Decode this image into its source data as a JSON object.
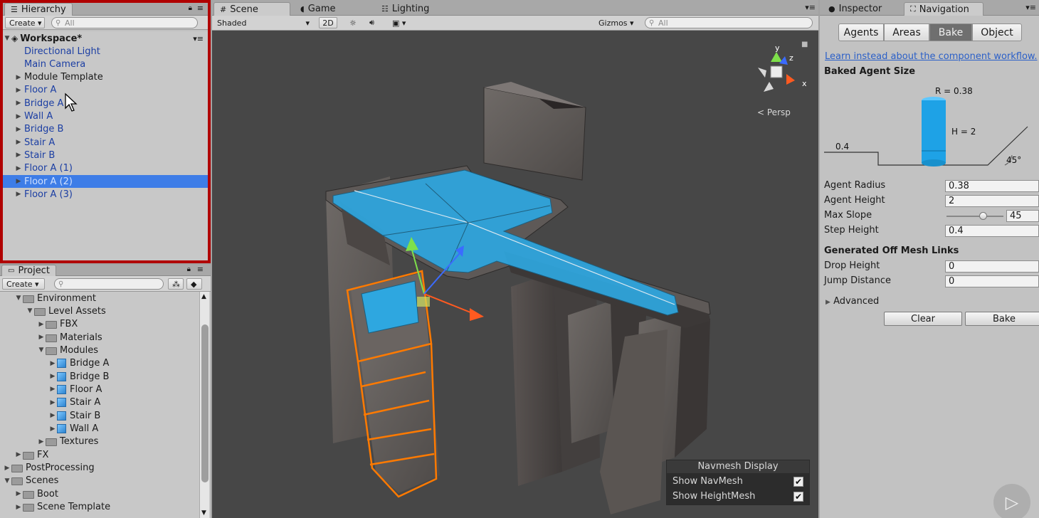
{
  "hierarchy": {
    "tab_label": "Hierarchy",
    "create_label": "Create",
    "search_placeholder": "All",
    "root": "Workspace*",
    "items": [
      {
        "label": "Directional Light",
        "expand": false
      },
      {
        "label": "Main Camera",
        "expand": false
      },
      {
        "label": "Module Template",
        "expand": true
      },
      {
        "label": "Floor A",
        "expand": true
      },
      {
        "label": "Bridge A",
        "expand": true
      },
      {
        "label": "Wall A",
        "expand": true
      },
      {
        "label": "Bridge B",
        "expand": true
      },
      {
        "label": "Stair A",
        "expand": true
      },
      {
        "label": "Stair B",
        "expand": true
      },
      {
        "label": "Floor A (1)",
        "expand": true
      },
      {
        "label": "Floor A (2)",
        "expand": true,
        "selected": true
      },
      {
        "label": "Floor A (3)",
        "expand": true
      }
    ]
  },
  "project": {
    "tab_label": "Project",
    "create_label": "Create",
    "items": [
      {
        "label": "Environment",
        "depth": 1,
        "state": "open",
        "icon": "folder-icon"
      },
      {
        "label": "Level Assets",
        "depth": 2,
        "state": "open",
        "icon": "folder-icon"
      },
      {
        "label": "FBX",
        "depth": 3,
        "state": "closed",
        "icon": "folder-icon"
      },
      {
        "label": "Materials",
        "depth": 3,
        "state": "closed",
        "icon": "folder-icon"
      },
      {
        "label": "Modules",
        "depth": 3,
        "state": "open",
        "icon": "folder-icon"
      },
      {
        "label": "Bridge A",
        "depth": 4,
        "state": "closed",
        "icon": "prefab-icon"
      },
      {
        "label": "Bridge B",
        "depth": 4,
        "state": "closed",
        "icon": "prefab-icon"
      },
      {
        "label": "Floor A",
        "depth": 4,
        "state": "closed",
        "icon": "prefab-icon"
      },
      {
        "label": "Stair A",
        "depth": 4,
        "state": "closed",
        "icon": "prefab-icon"
      },
      {
        "label": "Stair B",
        "depth": 4,
        "state": "closed",
        "icon": "prefab-icon"
      },
      {
        "label": "Wall A",
        "depth": 4,
        "state": "closed",
        "icon": "prefab-icon"
      },
      {
        "label": "Textures",
        "depth": 3,
        "state": "closed",
        "icon": "folder-icon"
      },
      {
        "label": "FX",
        "depth": 1,
        "state": "closed",
        "icon": "folder-icon"
      },
      {
        "label": "PostProcessing",
        "depth": 0,
        "state": "closed",
        "icon": "folder-icon"
      },
      {
        "label": "Scenes",
        "depth": 0,
        "state": "open",
        "icon": "folder-icon"
      },
      {
        "label": "Boot",
        "depth": 1,
        "state": "closed",
        "icon": "folder-icon"
      },
      {
        "label": "Scene Template",
        "depth": 1,
        "state": "closed",
        "icon": "folder-icon"
      }
    ]
  },
  "scene": {
    "tabs": [
      "Scene",
      "Game",
      "Lighting"
    ],
    "shading": "Shaded",
    "mode_2d": "2D",
    "gizmos": "Gizmos",
    "search_placeholder": "All",
    "persp": "Persp",
    "axis_y": "y",
    "axis_z": "z",
    "axis_x": "x",
    "navmesh_display": {
      "title": "Navmesh Display",
      "show_navmesh": "Show NavMesh",
      "show_heightmesh": "Show HeightMesh",
      "show_navmesh_checked": true,
      "show_heightmesh_checked": true
    }
  },
  "inspector": {
    "tabs": [
      "Inspector",
      "Navigation"
    ],
    "nav_tabs": [
      "Agents",
      "Areas",
      "Bake",
      "Object"
    ],
    "active_nav_tab": "Bake",
    "link": "Learn instead about the component workflow.",
    "baked_title": "Baked Agent Size",
    "diagram": {
      "r": "R = 0.38",
      "h": "H = 2",
      "step": "0.4",
      "slope": "45°"
    },
    "fields": [
      {
        "label": "Agent Radius",
        "value": "0.38"
      },
      {
        "label": "Agent Height",
        "value": "2"
      },
      {
        "label": "Max Slope",
        "value": "45",
        "slider": 0.76
      },
      {
        "label": "Step Height",
        "value": "0.4"
      }
    ],
    "offmesh_title": "Generated Off Mesh Links",
    "offmesh_fields": [
      {
        "label": "Drop Height",
        "value": "0"
      },
      {
        "label": "Jump Distance",
        "value": "0"
      }
    ],
    "advanced": "Advanced",
    "clear": "Clear",
    "bake": "Bake"
  },
  "colors": {
    "selection": "#3e7de7",
    "navmesh": "#2ea7e0",
    "highlight": "#ff7a00",
    "red_outline": "#b00000"
  }
}
